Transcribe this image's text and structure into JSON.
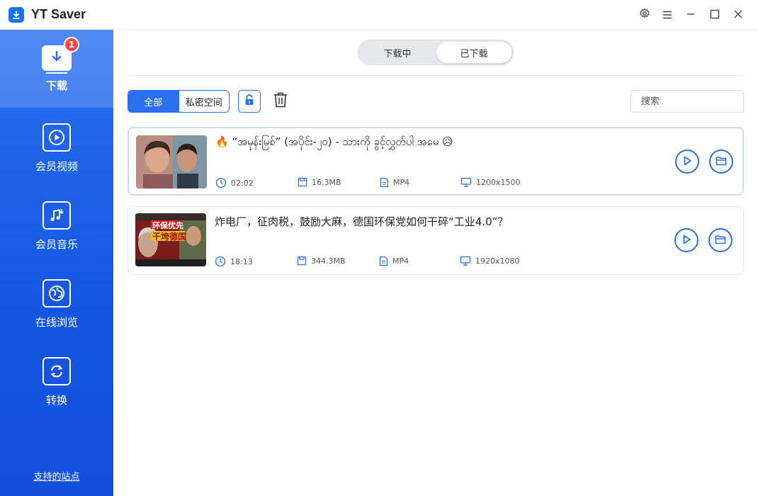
{
  "app": {
    "title": "YT Saver"
  },
  "window_controls": [
    "gear-icon",
    "menu-icon",
    "minimize-icon",
    "maximize-icon",
    "close-icon"
  ],
  "sidebar": {
    "items": [
      {
        "label": "下载",
        "icon": "download-icon",
        "badge": "1",
        "active": true
      },
      {
        "label": "会员视频",
        "icon": "play-video-icon"
      },
      {
        "label": "会员音乐",
        "icon": "music-icon"
      },
      {
        "label": "在线浏览",
        "icon": "globe-icon"
      },
      {
        "label": "转换",
        "icon": "convert-icon"
      }
    ],
    "support_link": "支持的站点"
  },
  "tabs": {
    "downloading": "下载中",
    "downloaded": "已下载",
    "active": "downloaded"
  },
  "filter": {
    "all": "全部",
    "private": "私密空间"
  },
  "search": {
    "placeholder": "搜索"
  },
  "downloads": [
    {
      "title": "🔥 “အမုန်းမြစ်” (အပိုင်း-၂၀) - သားကို ခွင့်လွှတ်ပါ အမေ 😥",
      "duration": "02:02",
      "size": "16.3MB",
      "format": "MP4",
      "resolution": "1200x1500",
      "selected": true
    },
    {
      "title": "炸电厂，征肉税，鼓励大麻，德国环保党如何干碎“工业4.0”？",
      "duration": "18:13",
      "size": "344.3MB",
      "format": "MP4",
      "resolution": "1920x1080",
      "thumb_text": [
        "环保优先",
        "干垮德国"
      ],
      "selected": false
    }
  ],
  "colors": {
    "accent": "#2a6ff0",
    "badge": "#f24a4a"
  }
}
